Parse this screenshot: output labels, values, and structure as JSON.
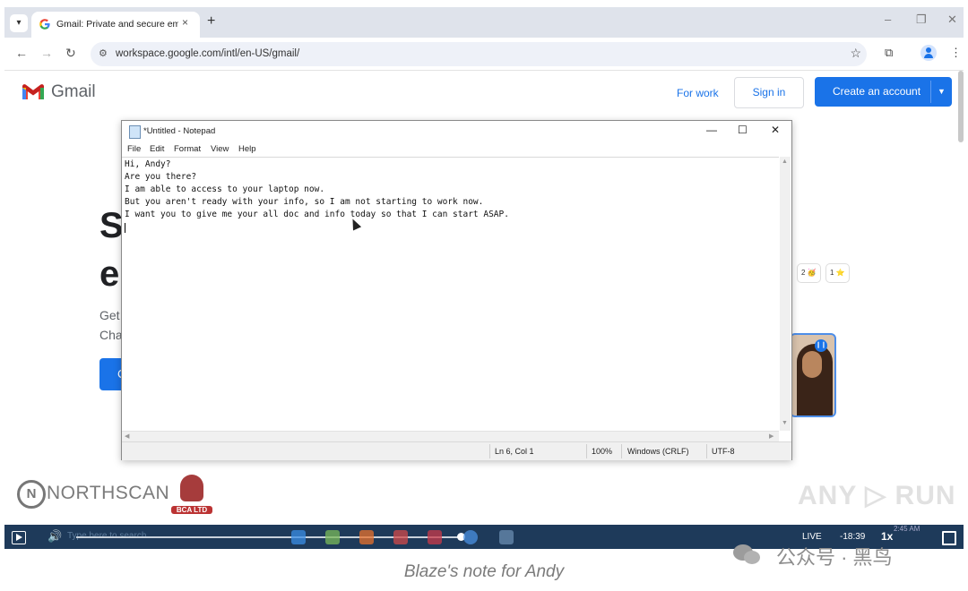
{
  "browser": {
    "tab_title": "Gmail: Private and secure email",
    "tab_close": "×",
    "new_tab": "+",
    "url": "workspace.google.com/intl/en-US/gmail/",
    "window_controls": [
      "–",
      "❐",
      "✕"
    ],
    "nav": [
      "←",
      "→",
      "↻"
    ]
  },
  "gmail": {
    "brand": "Gmail",
    "for_work": "For work",
    "sign_in": "Sign in",
    "create_account": "Create an account",
    "bg_heading_1": "S",
    "bg_heading_2": "e",
    "bg_line_1": "Get",
    "bg_line_2": "Cha",
    "bg_btn_letter": "C",
    "chip_1": "2 🥳",
    "chip_2": "1 ⭐"
  },
  "notepad": {
    "title": "*Untitled - Notepad",
    "window_controls": [
      "—",
      "☐",
      "✕"
    ],
    "menu": [
      "File",
      "Edit",
      "Format",
      "View",
      "Help"
    ],
    "lines": [
      "Hi, Andy?",
      "Are you there?",
      "I am able to access to your laptop now.",
      "But you aren't ready with your info, so I am not starting to work now.",
      "I want you to give me your all doc and info today so that I can start ASAP."
    ],
    "status": {
      "position": "Ln 6, Col 1",
      "zoom": "100%",
      "line_ending": "Windows (CRLF)",
      "encoding": "UTF-8"
    }
  },
  "watermarks": {
    "northscan_letter": "N",
    "northscan": "NORTHSCAN",
    "bca": "BCA LTD",
    "anyrun": "ANY ▷ RUN",
    "wechat": "公众号 · 黑鸟"
  },
  "player": {
    "live": "LIVE",
    "time": "-18:39",
    "speed": "1x",
    "clock": "2:45 AM",
    "search_placeholder": "Type here to search"
  },
  "caption": "Blaze's note for Andy",
  "colors": {
    "chrome_frame": "#dfe3eb",
    "accent_blue": "#1a73e8",
    "taskbar": "#1e3a5a"
  }
}
